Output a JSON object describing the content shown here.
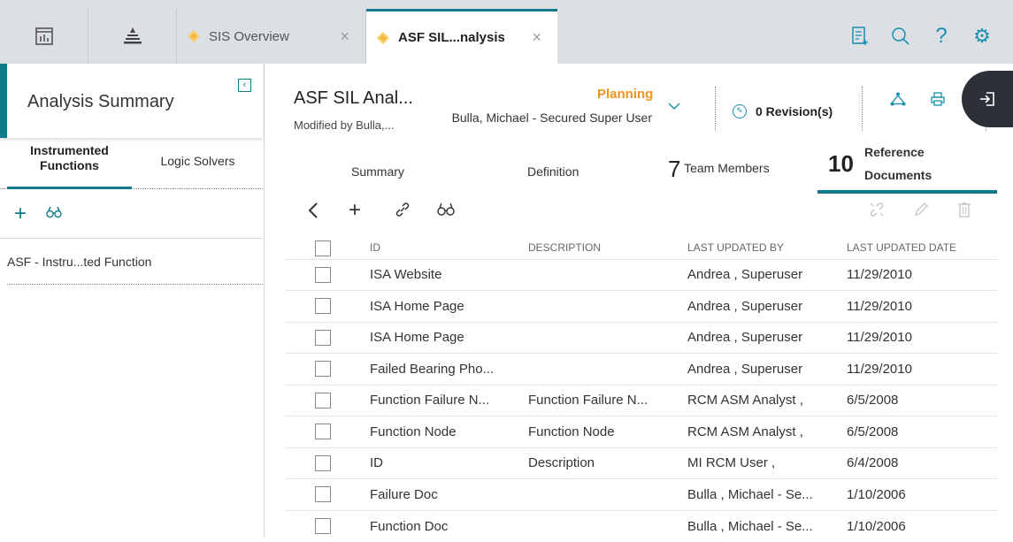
{
  "app": {
    "home_icon": "dashboard-icon",
    "hierarchy_icon": "hierarchy-icon"
  },
  "tabs": [
    {
      "label": "SIS Overview",
      "active": false
    },
    {
      "label": "ASF SIL...nalysis",
      "active": true
    }
  ],
  "top_icons": [
    "document-list-icon",
    "search-icon",
    "help-icon",
    "settings-icon"
  ],
  "left": {
    "title": "Analysis Summary",
    "tab_instrumented_line1": "Instrumented",
    "tab_instrumented_line2": "Functions",
    "tab_logic_solvers": "Logic Solvers",
    "items": [
      "ASF - Instru...ted Function"
    ]
  },
  "header": {
    "title": "ASF SIL Anal...",
    "subtitle": "Modified by Bulla,...",
    "status": "Planning",
    "owner": "Bulla, Michael - Secured Super User",
    "revisions": "0 Revision(s)"
  },
  "content_tabs": {
    "summary": "Summary",
    "definition": "Definition",
    "team_count": "7",
    "team_label": "Team Members",
    "ref_count": "10",
    "ref_label_1": "Reference",
    "ref_label_2": "Documents"
  },
  "table": {
    "headers": [
      "ID",
      "DESCRIPTION",
      "LAST UPDATED BY",
      "LAST UPDATED DATE"
    ],
    "rows": [
      [
        "ISA Website",
        "",
        "Andrea , Superuser",
        "11/29/2010"
      ],
      [
        "ISA Home Page",
        "",
        "Andrea , Superuser",
        "11/29/2010"
      ],
      [
        "ISA Home Page",
        "",
        "Andrea , Superuser",
        "11/29/2010"
      ],
      [
        "Failed Bearing Pho...",
        "",
        "Andrea , Superuser",
        "11/29/2010"
      ],
      [
        "Function Failure N...",
        "Function Failure N...",
        "RCM ASM Analyst ,",
        "6/5/2008"
      ],
      [
        "Function Node",
        "Function Node",
        "RCM ASM Analyst ,",
        "6/5/2008"
      ],
      [
        "ID",
        "Description",
        "MI RCM User ,",
        "6/4/2008"
      ],
      [
        "Failure Doc",
        "",
        "Bulla , Michael - Se...",
        "1/10/2006"
      ],
      [
        "Function Doc",
        "",
        "Bulla , Michael - Se...",
        "1/10/2006"
      ]
    ]
  },
  "colors": {
    "accent": "#117a8b",
    "icon_blue": "#1a8fb0",
    "status_orange": "#f0951c",
    "tab_bar": "#dcdfe4"
  }
}
